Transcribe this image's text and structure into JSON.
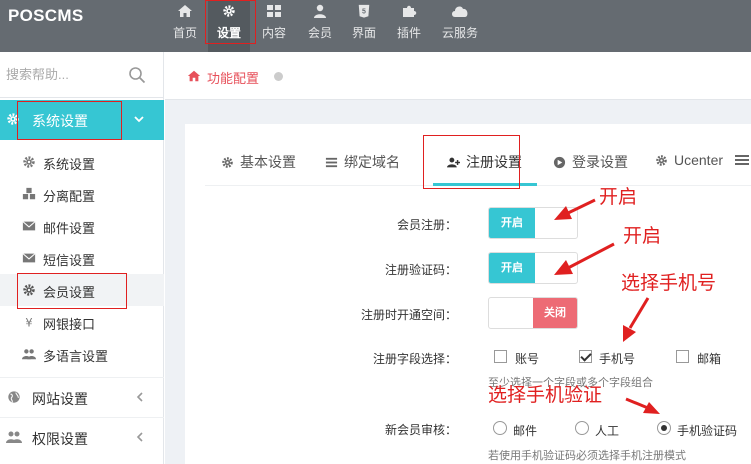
{
  "header": {
    "brand": "POSCMS",
    "nav": [
      {
        "label": "首页",
        "icon": "home-icon"
      },
      {
        "label": "设置",
        "icon": "gear-icon",
        "active": true
      },
      {
        "label": "内容",
        "icon": "grid-icon"
      },
      {
        "label": "会员",
        "icon": "user-icon"
      },
      {
        "label": "界面",
        "icon": "html5-icon"
      },
      {
        "label": "插件",
        "icon": "puzzle-icon"
      },
      {
        "label": "云服务",
        "icon": "cloud-icon"
      }
    ]
  },
  "sidebar": {
    "search_placeholder": "搜索帮助...",
    "section": {
      "label": "系统设置",
      "icon": "gear-icon"
    },
    "items": [
      {
        "label": "系统设置",
        "icon": "gear-icon"
      },
      {
        "label": "分离配置",
        "icon": "cubes-icon"
      },
      {
        "label": "邮件设置",
        "icon": "envelope-icon"
      },
      {
        "label": "短信设置",
        "icon": "envelope-icon"
      },
      {
        "label": "会员设置",
        "icon": "gear-icon",
        "active": true
      },
      {
        "label": "网银接口",
        "icon": "yen-icon"
      },
      {
        "label": "多语言设置",
        "icon": "users-icon"
      }
    ],
    "groups": [
      {
        "label": "网站设置",
        "icon": "globe-icon"
      },
      {
        "label": "权限设置",
        "icon": "users-icon"
      }
    ]
  },
  "breadcrumb": {
    "label": "功能配置",
    "icon": "home-icon"
  },
  "tabs": [
    {
      "label": "基本设置",
      "icon": "gear-icon"
    },
    {
      "label": "绑定域名",
      "icon": "list-icon"
    },
    {
      "label": "注册设置",
      "icon": "user-plus-icon",
      "active": true
    },
    {
      "label": "登录设置",
      "icon": "arrow-circle-icon"
    },
    {
      "label": "Ucenter",
      "icon": "gear-icon"
    }
  ],
  "form": {
    "register": {
      "label": "会员注册：",
      "state": "开启"
    },
    "captcha": {
      "label": "注册验证码：",
      "state": "开启"
    },
    "space": {
      "label": "注册时开通空间：",
      "state": "关闭"
    },
    "fields": {
      "label": "注册字段选择：",
      "options": [
        {
          "label": "账号",
          "checked": false
        },
        {
          "label": "手机号",
          "checked": true
        },
        {
          "label": "邮箱",
          "checked": false
        }
      ],
      "help": "至少选择一个字段或多个字段组合"
    },
    "audit": {
      "label": "新会员审核：",
      "options": [
        {
          "label": "邮件",
          "checked": false
        },
        {
          "label": "人工",
          "checked": false
        },
        {
          "label": "手机验证码",
          "checked": true
        }
      ],
      "help": "若使用手机验证码必须选择手机注册模式"
    }
  },
  "annotations": {
    "note1": "开启",
    "note2": "开启",
    "note3": "选择手机号",
    "note4": "选择手机验证"
  },
  "colors": {
    "accent": "#36c6d3",
    "danger": "#ed6b75",
    "header": "#656b71",
    "annotation": "#e02020"
  }
}
